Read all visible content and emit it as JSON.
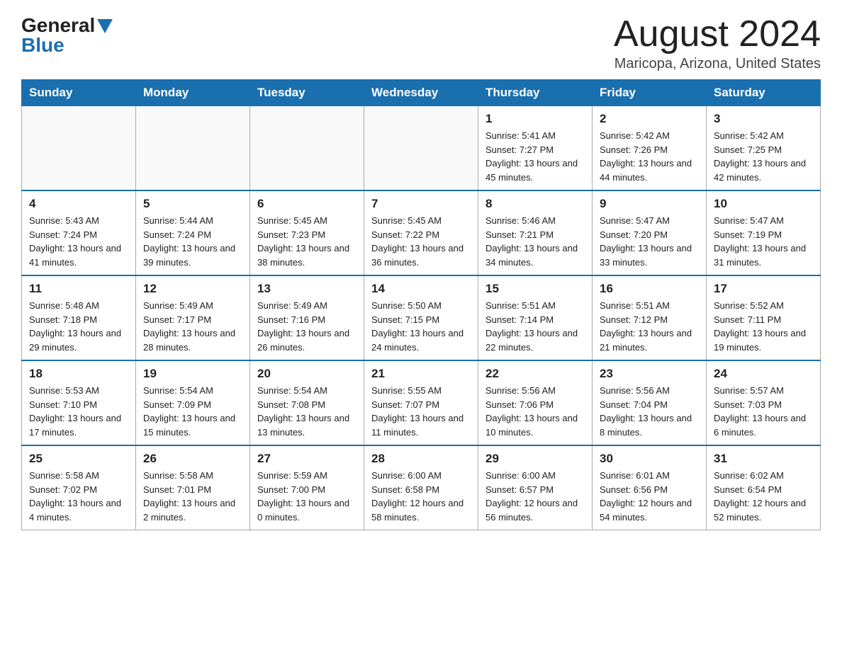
{
  "header": {
    "logo_general": "General",
    "logo_blue": "Blue",
    "month_title": "August 2024",
    "location": "Maricopa, Arizona, United States"
  },
  "calendar": {
    "days_of_week": [
      "Sunday",
      "Monday",
      "Tuesday",
      "Wednesday",
      "Thursday",
      "Friday",
      "Saturday"
    ],
    "weeks": [
      {
        "days": [
          {
            "number": "",
            "info": ""
          },
          {
            "number": "",
            "info": ""
          },
          {
            "number": "",
            "info": ""
          },
          {
            "number": "",
            "info": ""
          },
          {
            "number": "1",
            "info": "Sunrise: 5:41 AM\nSunset: 7:27 PM\nDaylight: 13 hours\nand 45 minutes."
          },
          {
            "number": "2",
            "info": "Sunrise: 5:42 AM\nSunset: 7:26 PM\nDaylight: 13 hours\nand 44 minutes."
          },
          {
            "number": "3",
            "info": "Sunrise: 5:42 AM\nSunset: 7:25 PM\nDaylight: 13 hours\nand 42 minutes."
          }
        ]
      },
      {
        "days": [
          {
            "number": "4",
            "info": "Sunrise: 5:43 AM\nSunset: 7:24 PM\nDaylight: 13 hours\nand 41 minutes."
          },
          {
            "number": "5",
            "info": "Sunrise: 5:44 AM\nSunset: 7:24 PM\nDaylight: 13 hours\nand 39 minutes."
          },
          {
            "number": "6",
            "info": "Sunrise: 5:45 AM\nSunset: 7:23 PM\nDaylight: 13 hours\nand 38 minutes."
          },
          {
            "number": "7",
            "info": "Sunrise: 5:45 AM\nSunset: 7:22 PM\nDaylight: 13 hours\nand 36 minutes."
          },
          {
            "number": "8",
            "info": "Sunrise: 5:46 AM\nSunset: 7:21 PM\nDaylight: 13 hours\nand 34 minutes."
          },
          {
            "number": "9",
            "info": "Sunrise: 5:47 AM\nSunset: 7:20 PM\nDaylight: 13 hours\nand 33 minutes."
          },
          {
            "number": "10",
            "info": "Sunrise: 5:47 AM\nSunset: 7:19 PM\nDaylight: 13 hours\nand 31 minutes."
          }
        ]
      },
      {
        "days": [
          {
            "number": "11",
            "info": "Sunrise: 5:48 AM\nSunset: 7:18 PM\nDaylight: 13 hours\nand 29 minutes."
          },
          {
            "number": "12",
            "info": "Sunrise: 5:49 AM\nSunset: 7:17 PM\nDaylight: 13 hours\nand 28 minutes."
          },
          {
            "number": "13",
            "info": "Sunrise: 5:49 AM\nSunset: 7:16 PM\nDaylight: 13 hours\nand 26 minutes."
          },
          {
            "number": "14",
            "info": "Sunrise: 5:50 AM\nSunset: 7:15 PM\nDaylight: 13 hours\nand 24 minutes."
          },
          {
            "number": "15",
            "info": "Sunrise: 5:51 AM\nSunset: 7:14 PM\nDaylight: 13 hours\nand 22 minutes."
          },
          {
            "number": "16",
            "info": "Sunrise: 5:51 AM\nSunset: 7:12 PM\nDaylight: 13 hours\nand 21 minutes."
          },
          {
            "number": "17",
            "info": "Sunrise: 5:52 AM\nSunset: 7:11 PM\nDaylight: 13 hours\nand 19 minutes."
          }
        ]
      },
      {
        "days": [
          {
            "number": "18",
            "info": "Sunrise: 5:53 AM\nSunset: 7:10 PM\nDaylight: 13 hours\nand 17 minutes."
          },
          {
            "number": "19",
            "info": "Sunrise: 5:54 AM\nSunset: 7:09 PM\nDaylight: 13 hours\nand 15 minutes."
          },
          {
            "number": "20",
            "info": "Sunrise: 5:54 AM\nSunset: 7:08 PM\nDaylight: 13 hours\nand 13 minutes."
          },
          {
            "number": "21",
            "info": "Sunrise: 5:55 AM\nSunset: 7:07 PM\nDaylight: 13 hours\nand 11 minutes."
          },
          {
            "number": "22",
            "info": "Sunrise: 5:56 AM\nSunset: 7:06 PM\nDaylight: 13 hours\nand 10 minutes."
          },
          {
            "number": "23",
            "info": "Sunrise: 5:56 AM\nSunset: 7:04 PM\nDaylight: 13 hours\nand 8 minutes."
          },
          {
            "number": "24",
            "info": "Sunrise: 5:57 AM\nSunset: 7:03 PM\nDaylight: 13 hours\nand 6 minutes."
          }
        ]
      },
      {
        "days": [
          {
            "number": "25",
            "info": "Sunrise: 5:58 AM\nSunset: 7:02 PM\nDaylight: 13 hours\nand 4 minutes."
          },
          {
            "number": "26",
            "info": "Sunrise: 5:58 AM\nSunset: 7:01 PM\nDaylight: 13 hours\nand 2 minutes."
          },
          {
            "number": "27",
            "info": "Sunrise: 5:59 AM\nSunset: 7:00 PM\nDaylight: 13 hours\nand 0 minutes."
          },
          {
            "number": "28",
            "info": "Sunrise: 6:00 AM\nSunset: 6:58 PM\nDaylight: 12 hours\nand 58 minutes."
          },
          {
            "number": "29",
            "info": "Sunrise: 6:00 AM\nSunset: 6:57 PM\nDaylight: 12 hours\nand 56 minutes."
          },
          {
            "number": "30",
            "info": "Sunrise: 6:01 AM\nSunset: 6:56 PM\nDaylight: 12 hours\nand 54 minutes."
          },
          {
            "number": "31",
            "info": "Sunrise: 6:02 AM\nSunset: 6:54 PM\nDaylight: 12 hours\nand 52 minutes."
          }
        ]
      }
    ]
  }
}
